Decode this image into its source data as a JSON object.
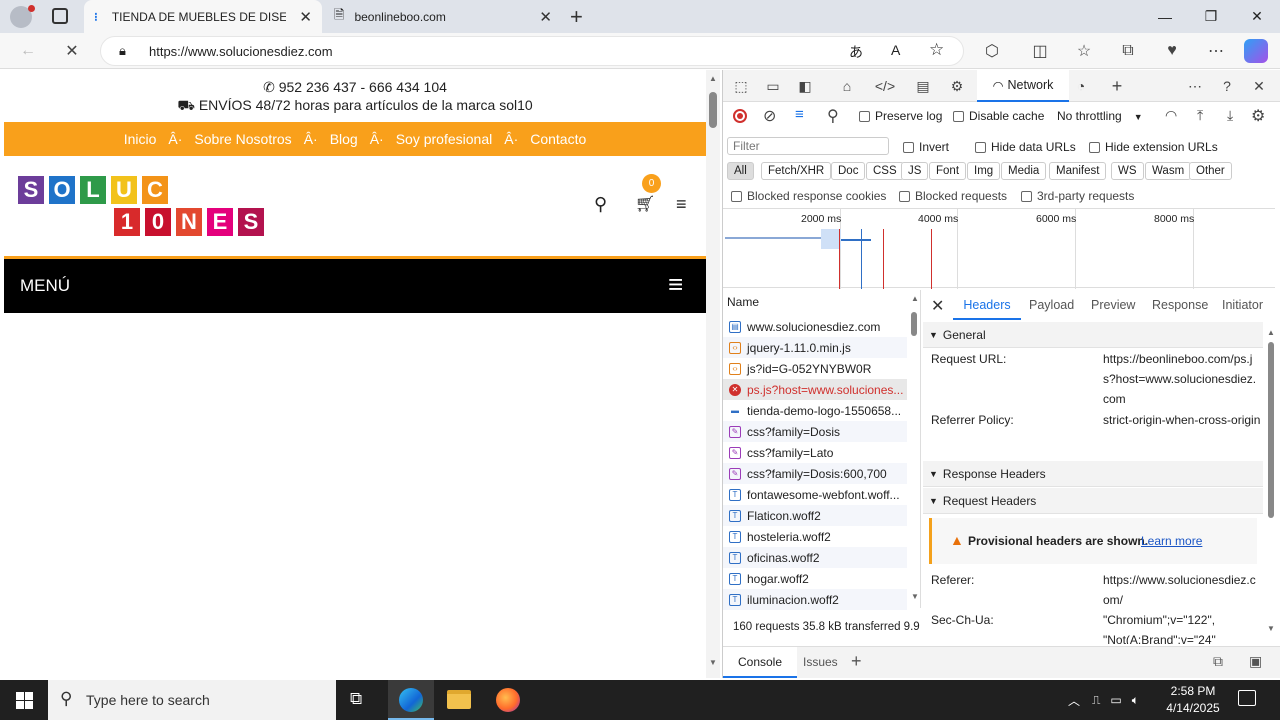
{
  "browser": {
    "tabs": [
      {
        "title": "TIENDA DE MUEBLES DE DISEÑO",
        "active": true
      },
      {
        "title": "beonlineboo.com",
        "active": false
      }
    ],
    "url": "https://www.solucionesdiez.com"
  },
  "website": {
    "phone": "952 236 437 - 666 434 104",
    "shipping": "ENVÍOS 48/72 horas para artículos de la marca sol10",
    "nav": [
      "Inicio",
      "Â·",
      "Sobre Nosotros",
      "Â·",
      "Blog",
      "Â·",
      "Soy profesional",
      "Â·",
      "Contacto"
    ],
    "logo_top": [
      "S",
      "O",
      "L",
      "U",
      "C"
    ],
    "logo_bottom": [
      "1",
      "0",
      "N",
      "E",
      "S"
    ],
    "cart_count": "0",
    "menu_label": "MENÚ",
    "colors": {
      "accent": "#f9a01b",
      "menubar": "#000000"
    }
  },
  "devtools": {
    "active_tool": "Network",
    "preserve_log": "Preserve log",
    "disable_cache": "Disable cache",
    "throttling": "No throttling",
    "filter_placeholder": "Filter",
    "invert": "Invert",
    "hide_data_urls": "Hide data URLs",
    "hide_ext_urls": "Hide extension URLs",
    "type_filters": [
      "All",
      "Fetch/XHR",
      "Doc",
      "CSS",
      "JS",
      "Font",
      "Img",
      "Media",
      "Manifest",
      "WS",
      "Wasm",
      "Other"
    ],
    "blocked_cookies": "Blocked response cookies",
    "blocked_requests": "Blocked requests",
    "third_party": "3rd-party requests",
    "timeline_ticks": [
      "2000 ms",
      "4000 ms",
      "6000 ms",
      "8000 ms"
    ],
    "name_header": "Name",
    "requests": [
      {
        "name": "www.solucionesdiez.com",
        "type": "doc"
      },
      {
        "name": "jquery-1.11.0.min.js",
        "type": "js"
      },
      {
        "name": "js?id=G-052YNYBW0R",
        "type": "js"
      },
      {
        "name": "ps.js?host=www.soluciones...",
        "type": "error"
      },
      {
        "name": "tienda-demo-logo-1550658...",
        "type": "img"
      },
      {
        "name": "css?family=Dosis",
        "type": "css"
      },
      {
        "name": "css?family=Lato",
        "type": "css"
      },
      {
        "name": "css?family=Dosis:600,700",
        "type": "css"
      },
      {
        "name": "fontawesome-webfont.woff...",
        "type": "font"
      },
      {
        "name": "Flaticon.woff2",
        "type": "font"
      },
      {
        "name": "hosteleria.woff2",
        "type": "font"
      },
      {
        "name": "oficinas.woff2",
        "type": "font"
      },
      {
        "name": "hogar.woff2",
        "type": "font"
      },
      {
        "name": "iluminacion.woff2",
        "type": "font"
      }
    ],
    "summary": "160 requests  35.8 kB transferred  9.9",
    "detail_tabs": [
      "Headers",
      "Payload",
      "Preview",
      "Response",
      "Initiator"
    ],
    "general_label": "General",
    "request_url_label": "Request URL:",
    "request_url_value": "https://beonlineboo.com/ps.js?host=www.solucionesdiez.com",
    "referrer_policy_label": "Referrer Policy:",
    "referrer_policy_value": "strict-origin-when-cross-origin",
    "response_headers": "Response Headers",
    "request_headers": "Request Headers",
    "provisional_warning": "Provisional headers are shown.",
    "learn_more": "Learn more",
    "referer_label": "Referer:",
    "referer_value": "https://www.solucionesdiez.com/",
    "sec_ch_ua_label": "Sec-Ch-Ua:",
    "sec_ch_ua_value": "\"Chromium\";v=\"122\", \"Not(A:Brand\";v=\"24\"",
    "drawer_tabs": [
      "Console",
      "Issues"
    ]
  },
  "taskbar": {
    "search_placeholder": "Type here to search",
    "time": "2:58 PM",
    "date": "4/14/2025"
  }
}
